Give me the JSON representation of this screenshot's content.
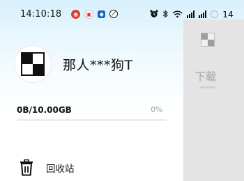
{
  "status_bar": {
    "time": "14:10:18",
    "battery_level": "14",
    "notification_icons": [
      "weibo-icon",
      "app-icon",
      "blue-app-icon",
      "compass-icon"
    ]
  },
  "profile": {
    "username": "那人***狗T"
  },
  "storage": {
    "used_total": "0B/10.00GB",
    "percent": "0%",
    "fraction": 0
  },
  "side_panel": {
    "tab_label": "下载"
  },
  "menu": {
    "items": [
      {
        "label": "回收站",
        "icon": "trash-icon"
      }
    ]
  },
  "colors": {
    "accent": "#4a90e2",
    "gradient_top": "#d7f0fb",
    "panel_bg": "#e4e4e4"
  }
}
